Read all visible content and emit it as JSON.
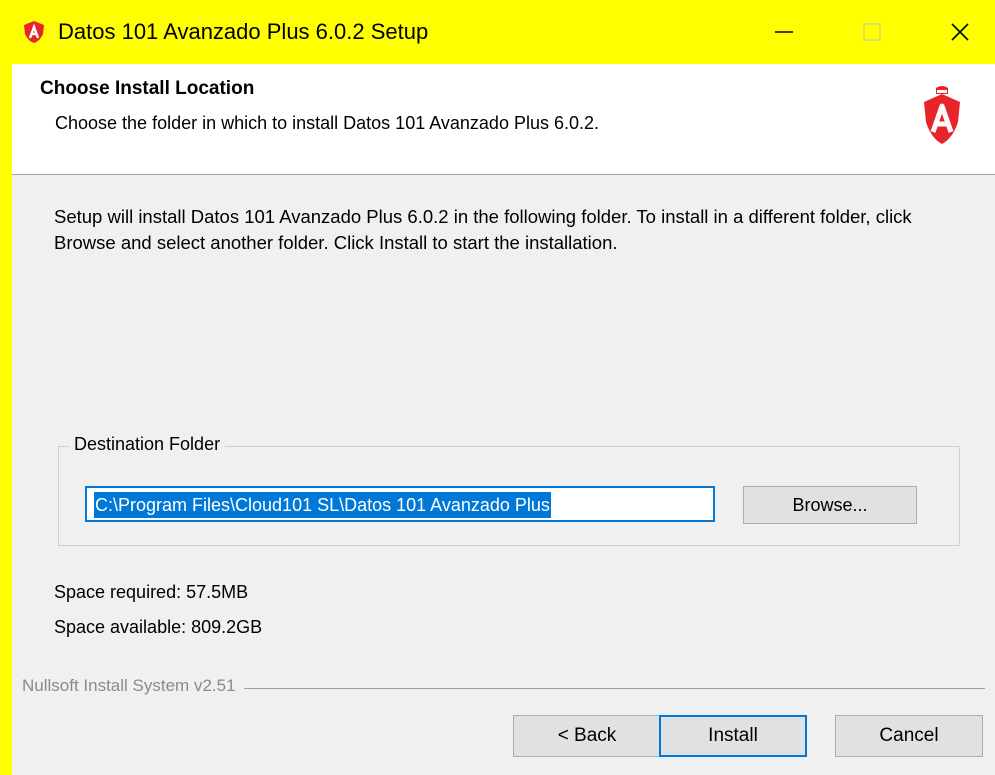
{
  "window": {
    "title": "Datos 101 Avanzado Plus 6.0.2 Setup",
    "titlebar_color": "#ffff00",
    "app_icon": "shield-a-icon",
    "controls": {
      "minimize": "minimize-icon",
      "maximize": "maximize-icon",
      "close": "close-icon"
    }
  },
  "header": {
    "title": "Choose Install Location",
    "subtitle": "Choose the folder in which to install Datos 101 Avanzado Plus 6.0.2.",
    "logo": "shield-a-icon",
    "brand_color": "#e8232a"
  },
  "main": {
    "intro": "Setup will install Datos 101 Avanzado Plus 6.0.2 in the following folder. To install in a different folder, click Browse and select another folder. Click Install to start the installation.",
    "destination": {
      "legend": "Destination Folder",
      "path_value": "C:\\Program Files\\Cloud101 SL\\Datos 101 Avanzado Plus",
      "browse_label": "Browse..."
    },
    "space_required": "Space required: 57.5MB",
    "space_available": "Space available: 809.2GB"
  },
  "footer": {
    "branding": "Nullsoft Install System v2.51",
    "back_label": "< Back",
    "install_label": "Install",
    "cancel_label": "Cancel"
  },
  "colors": {
    "accent": "#0078d7",
    "dialog_bg": "#f0f0f0"
  }
}
